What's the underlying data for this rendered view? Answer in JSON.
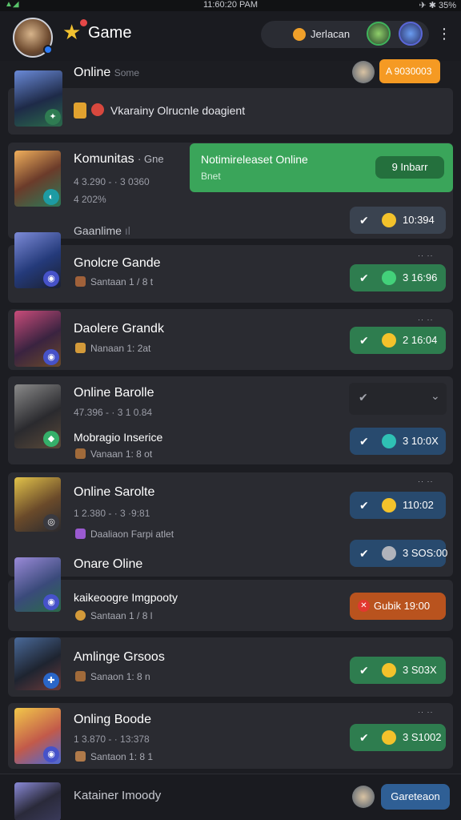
{
  "status": {
    "time": "11:60:20 PAM",
    "right": "✈ ✱ 35%"
  },
  "app": {
    "title": "Game"
  },
  "header": {
    "pill_label": "Jerlacan"
  },
  "topbar": {
    "title": "Online",
    "faded": "Some",
    "cta": "A 9030003"
  },
  "banner": {
    "text": "Vkarainy Olrucnle doagient"
  },
  "community": {
    "title": "Komunitas",
    "faded": "· Gne",
    "stat1": "4 3.290 - · 3 0360",
    "stat2": "4 202%",
    "sub2": "Gaanlime",
    "sub2_faded": "ıl"
  },
  "notification": {
    "title": "Notimireleaset Online",
    "sub": "Bnet",
    "button": "9 Inbarr"
  },
  "games": [
    {
      "title": "Gnolcre Gande",
      "meta": "Santaan 1 / 8 t",
      "value": "10:394",
      "secondary_value": "3 16:96",
      "sub": ""
    },
    {
      "title": "Daolere Grandk",
      "meta": "Nanaan 1: 2at",
      "value": "2 16:04",
      "sub": ""
    },
    {
      "title": "Online Barolle",
      "sub": "47.396 - · 3 1 0.84",
      "title2": "Mobragio Inserice",
      "meta": "Vanaan 1: 8 ot",
      "value": "3 10:0X"
    },
    {
      "title": "Online Sarolte",
      "sub": "1 2.380 - · 3 ·9:81",
      "meta": "Daaliaon Farpi atlet",
      "value": "110:02",
      "value2": "3 SOS:00"
    },
    {
      "title": "Onare Oline",
      "title2": "kaikeoogre Imgpooty",
      "meta": "Santaan 1 / 8 l",
      "value": "Gubik 19:00"
    },
    {
      "title": "Amlinge Grsoos",
      "meta": "Sanaon 1: 8 n",
      "value": "3 S03X"
    },
    {
      "title": "Onling Boode",
      "sub": "1 3.870 - · 13:378",
      "meta": "Santaon 1: 8 1",
      "value": "3 S1002"
    }
  ],
  "footer": {
    "title": "Katainer Imoody",
    "button": "Gareteaon"
  },
  "colors": {
    "green": "#3fa35f",
    "blue": "#2e5d8f",
    "orange": "#c75a1f",
    "cta": "#f59a23"
  }
}
